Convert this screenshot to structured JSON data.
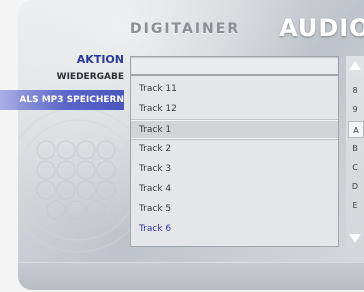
{
  "header": {
    "brand": "DIGITAINER",
    "title": "AUDIO"
  },
  "menu": {
    "heading": "AKTION",
    "items": [
      {
        "label": "WIEDERGABE",
        "selected": false
      },
      {
        "label": "ALS MP3 SPEICHERN",
        "selected": true
      }
    ]
  },
  "input": {
    "value": ""
  },
  "tracks": [
    {
      "label": "Track 11",
      "highlighted": false
    },
    {
      "label": "Track 12",
      "highlighted": false
    },
    {
      "label": "Track 1",
      "highlighted": true
    },
    {
      "label": "Track 2",
      "highlighted": false
    },
    {
      "label": "Track 3",
      "highlighted": false
    },
    {
      "label": "Track 4",
      "highlighted": false
    },
    {
      "label": "Track 5",
      "highlighted": false
    },
    {
      "label": "Track 6",
      "highlighted": false,
      "accent": true
    }
  ],
  "index": {
    "letters": [
      "8",
      "9",
      "A",
      "B",
      "C",
      "D",
      "E"
    ],
    "active": "A"
  },
  "colors": {
    "accent": "#4b55bd",
    "heading": "#2c3a9a",
    "track_accent": "#2a3490"
  },
  "icons": {
    "up": "triangle-up-icon",
    "down": "triangle-down-icon"
  }
}
